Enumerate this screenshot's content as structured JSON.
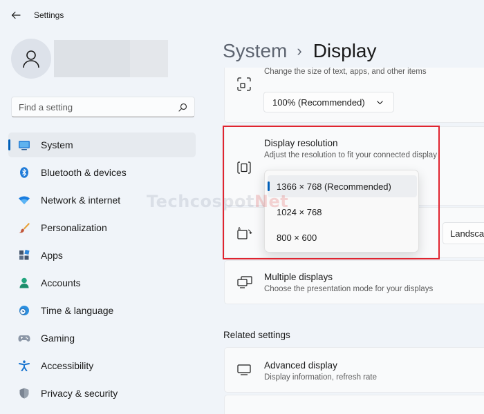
{
  "window": {
    "title": "Settings"
  },
  "search": {
    "placeholder": "Find a setting"
  },
  "sidebar": {
    "items": [
      {
        "label": "System",
        "icon": "monitor-icon",
        "active": true
      },
      {
        "label": "Bluetooth & devices",
        "icon": "bluetooth-icon"
      },
      {
        "label": "Network & internet",
        "icon": "wifi-icon"
      },
      {
        "label": "Personalization",
        "icon": "brush-icon"
      },
      {
        "label": "Apps",
        "icon": "apps-icon"
      },
      {
        "label": "Accounts",
        "icon": "person-icon"
      },
      {
        "label": "Time & language",
        "icon": "clock-globe-icon"
      },
      {
        "label": "Gaming",
        "icon": "gamepad-icon"
      },
      {
        "label": "Accessibility",
        "icon": "accessibility-icon"
      },
      {
        "label": "Privacy & security",
        "icon": "shield-icon"
      }
    ]
  },
  "breadcrumb": {
    "parent": "System",
    "separator": "›",
    "current": "Display"
  },
  "scale_card": {
    "subtitle": "Change the size of text, apps, and other items",
    "value": "100% (Recommended)"
  },
  "resolution_card": {
    "title": "Display resolution",
    "subtitle": "Adjust the resolution to fit your connected display",
    "options": [
      "1366 × 768 (Recommended)",
      "1024 × 768",
      "800 × 600"
    ],
    "selected_index": 0
  },
  "orientation_card": {
    "value": "Landscape"
  },
  "multiple_displays": {
    "title": "Multiple displays",
    "subtitle": "Choose the presentation mode for your displays"
  },
  "related": {
    "heading": "Related settings",
    "advanced_title": "Advanced display",
    "advanced_subtitle": "Display information, refresh rate"
  },
  "watermark": {
    "text_main": "Techcospot",
    "text_accent": "Net"
  },
  "colors": {
    "accent": "#005fb8",
    "highlight": "#e0242f",
    "background": "#f0f4f9",
    "card": "#f9fafb"
  }
}
